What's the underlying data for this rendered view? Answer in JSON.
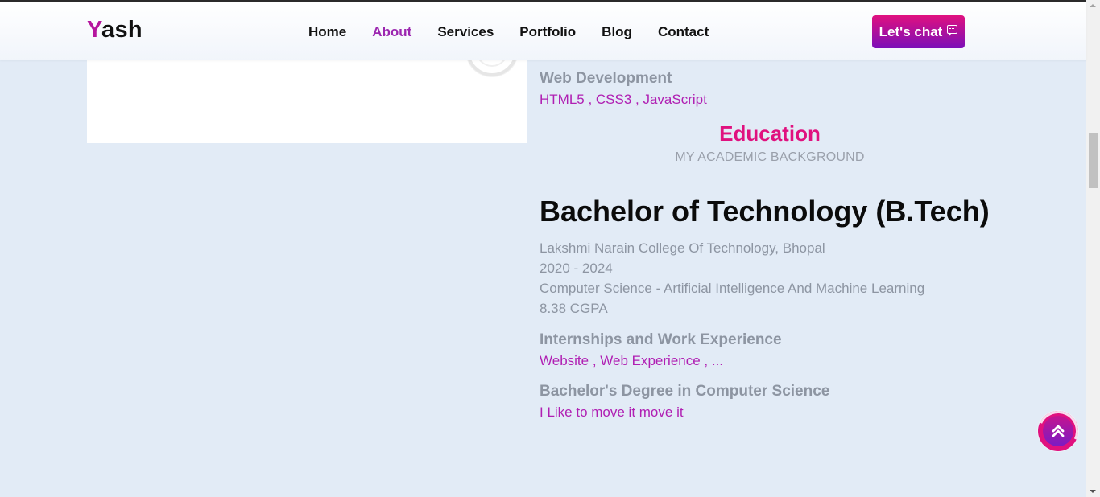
{
  "header": {
    "logo_first": "Y",
    "logo_rest": "ash",
    "nav": [
      "Home",
      "About",
      "Services",
      "Portfolio",
      "Blog",
      "Contact"
    ],
    "active_nav": "About",
    "chat_label": "Let's chat"
  },
  "skills": {
    "title": "Web Development",
    "sub": "HTML5 , CSS3 , JavaScript"
  },
  "education": {
    "heading": "Education",
    "subheading": "MY ACADEMIC BACKGROUND",
    "degree": "Bachelor of Technology (B.Tech)",
    "college": "Lakshmi Narain College Of Technology, Bhopal",
    "years": "2020 - 2024",
    "branch": "Computer Science - Artificial Intelligence And Machine Learning",
    "cgpa": "8.38 CGPA"
  },
  "experience": {
    "title": "Internships and Work Experience",
    "sub": "Website , Web Experience , ..."
  },
  "other": {
    "title": "Bachelor's Degree in Computer Science",
    "sub": "I Like to move it move it"
  },
  "colors": {
    "accent_pink": "#e0117f",
    "accent_purple": "#9c27b0",
    "background": "#e2ebf6"
  },
  "icons": {
    "chat": "chat-bubble-icon",
    "back_to_top": "double-chevron-up-icon"
  }
}
